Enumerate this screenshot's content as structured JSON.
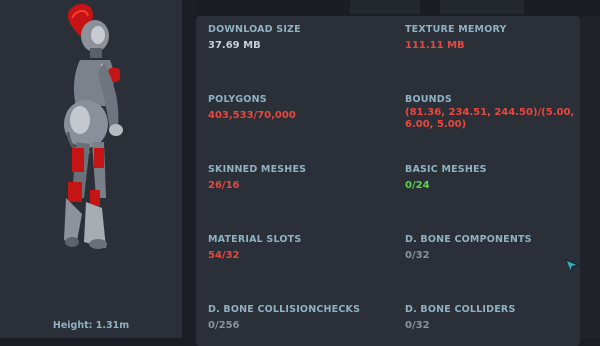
{
  "model_panel": {
    "height_label": "Height: 1.31m"
  },
  "stats": {
    "download_size": {
      "label": "DOWNLOAD SIZE",
      "value": "37.69 MB",
      "status": "ok"
    },
    "texture_memory": {
      "label": "TEXTURE MEMORY",
      "value": "111.11 MB",
      "status": "over"
    },
    "polygons": {
      "label": "POLYGONS",
      "value": "403,533/70,000",
      "status": "over"
    },
    "bounds": {
      "label": "BOUNDS",
      "value": "(81.36, 234.51, 244.50)/(5.00, 6.00, 5.00)",
      "status": "over"
    },
    "skinned_meshes": {
      "label": "SKINNED MESHES",
      "value": "26/16",
      "status": "over"
    },
    "basic_meshes": {
      "label": "BASIC MESHES",
      "value": "0/24",
      "status": "good"
    },
    "material_slots": {
      "label": "MATERIAL SLOTS",
      "value": "54/32",
      "status": "over"
    },
    "d_bone_components": {
      "label": "D. BONE COMPONENTS",
      "value": "0/32",
      "status": "neutral"
    },
    "d_bone_collisionchecks": {
      "label": "D. BONE COLLISIONCHECKS",
      "value": "0/256",
      "status": "neutral"
    },
    "d_bone_colliders": {
      "label": "D. BONE COLLIDERS",
      "value": "0/32",
      "status": "neutral"
    }
  },
  "colors": {
    "label": "#8fb2c2",
    "value_ok": "#c9ced6",
    "value_over": "#e8473f",
    "value_good": "#5fd14e",
    "value_neutral": "#8b929c"
  }
}
